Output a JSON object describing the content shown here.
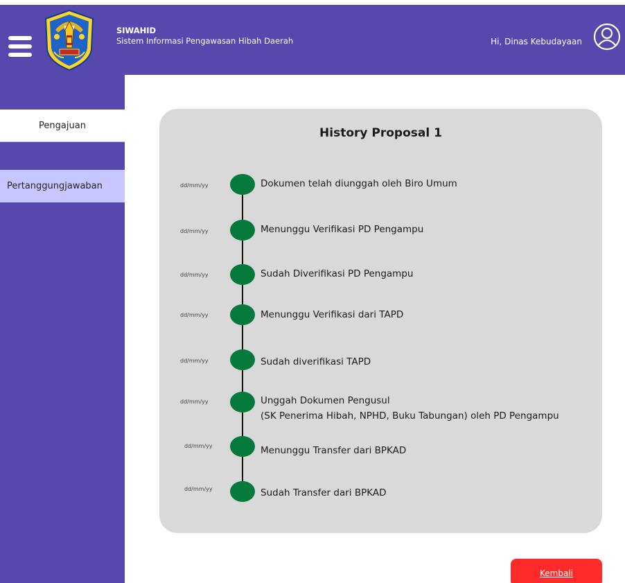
{
  "header": {
    "app_name": "SIWAHID",
    "app_subtitle": "Sistem Informasi Pengawasan Hibah Daerah",
    "greeting": "Hi, Dinas Kebudayaan"
  },
  "sidebar": {
    "items": [
      {
        "label": "Pengajuan",
        "active": true
      },
      {
        "label": "Pertanggungjawaban",
        "active": false
      }
    ]
  },
  "history": {
    "title": "History Proposal 1",
    "entries": [
      {
        "date": "dd/mm/yy",
        "text": "Dokumen telah diunggah oleh Biro Umum"
      },
      {
        "date": "dd/mm/yy",
        "text": "Menunggu Verifikasi PD Pengampu"
      },
      {
        "date": "dd/mm/yy",
        "text": "Sudah Diverifikasi PD Pengampu"
      },
      {
        "date": "dd/mm/yy",
        "text": "Menunggu Verifikasi dari TAPD"
      },
      {
        "date": "dd/mm/yy",
        "text": "Sudah diverifikasi TAPD"
      },
      {
        "date": "dd/mm/yy",
        "text": "Unggah Dokumen Pengusul",
        "text2": "(SK Penerima Hibah, NPHD, Buku Tabungan) oleh PD Pengampu"
      },
      {
        "date": "dd/mm/yy",
        "text": "Menunggu Transfer dari BPKAD"
      },
      {
        "date": "dd/mm/yy",
        "text": "Sudah Transfer dari BPKAD"
      }
    ]
  },
  "actions": {
    "back_label": "Kembali"
  },
  "colors": {
    "primary": "#5648ad",
    "sidebar_highlight": "#c8c6ff",
    "card_background": "#d9d9d9",
    "timeline_dot": "#067a3d",
    "back_button": "#ff2a2a"
  },
  "icons": {
    "menu": "hamburger-menu-icon",
    "user": "user-profile-icon",
    "logo": "emblem-logo"
  }
}
